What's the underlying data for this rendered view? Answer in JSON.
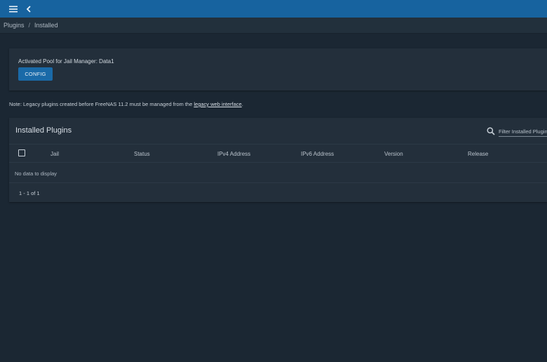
{
  "header": {
    "menu_icon": "menu-icon",
    "back_icon": "chevron-left-icon",
    "bar_color": "#17639f"
  },
  "breadcrumb": {
    "items": [
      "Plugins",
      "Installed"
    ],
    "separator": "/"
  },
  "pool": {
    "label": "Activated Pool for Jail Manager: Data1",
    "config_button": "CONFIG"
  },
  "note": {
    "prefix": "Note: Legacy plugins created before FreeNAS 11.2 must be managed from the",
    "link": "legacy web interface",
    "suffix": "."
  },
  "plugins": {
    "title": "Installed Plugins",
    "filter_placeholder": "Filter Installed Plugins",
    "columns": [
      "Jail",
      "Status",
      "IPv4 Address",
      "IPv6 Address",
      "Version",
      "Release"
    ],
    "empty_message": "No data to display",
    "pagination": "1 - 1 of 1"
  }
}
